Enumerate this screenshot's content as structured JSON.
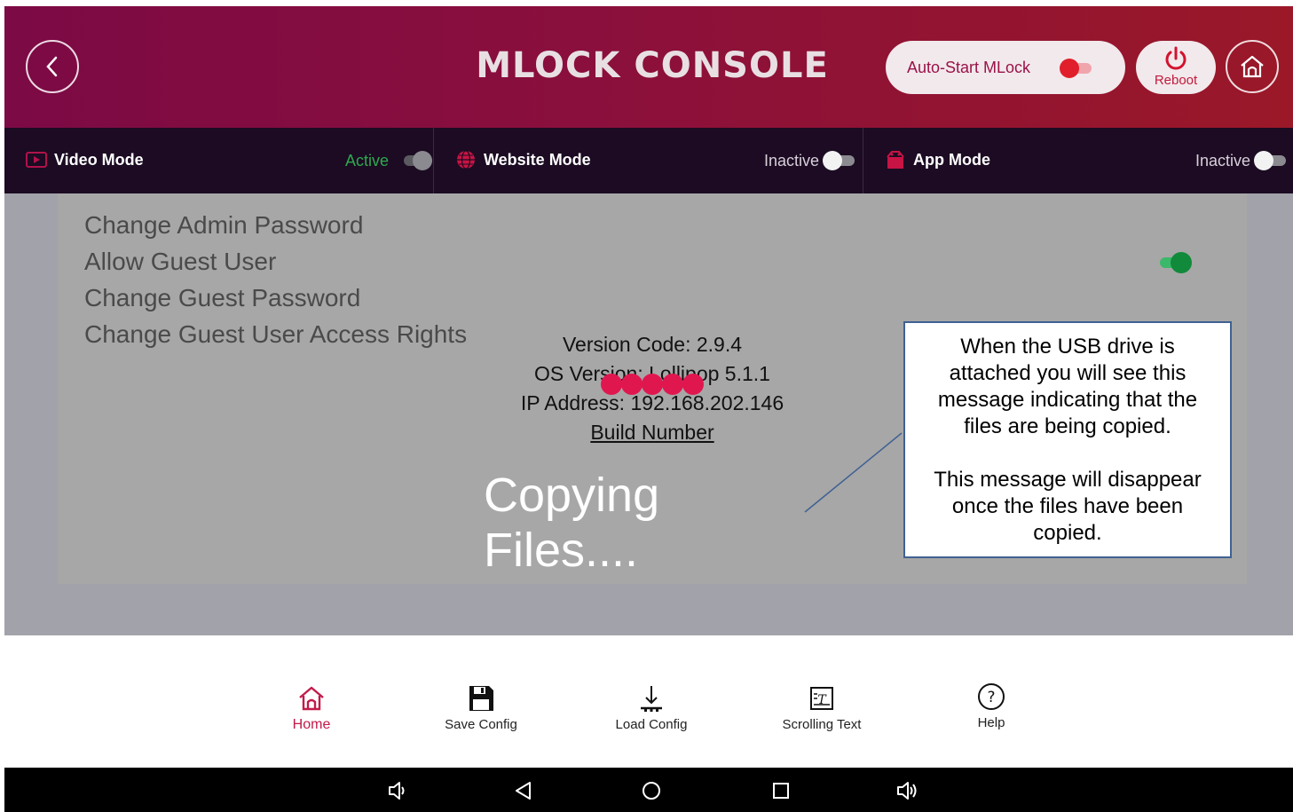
{
  "header": {
    "title": "MLOCK CONSOLE",
    "autostart_label": "Auto-Start MLock",
    "autostart_on": false,
    "reboot_label": "Reboot"
  },
  "modes": [
    {
      "label": "Video Mode",
      "status": "Active",
      "icon": "video-icon"
    },
    {
      "label": "Website Mode",
      "status": "Inactive",
      "icon": "globe-icon"
    },
    {
      "label": "App Mode",
      "status": "Inactive",
      "icon": "app-icon"
    }
  ],
  "settings": {
    "items": [
      "Change Admin Password",
      "Allow Guest User",
      "Change Guest Password",
      "Change Guest User Access Rights"
    ],
    "allow_guest_enabled": true
  },
  "info": {
    "version_code": "Version Code: 2.9.4",
    "os_version": "OS Version: Lollipop 5.1.1",
    "ip_address": "IP Address: 192.168.202.146",
    "build_number": "Build Number"
  },
  "overlay": {
    "copying": "Copying Files....",
    "progress_dots": 5
  },
  "callout": {
    "paragraph1": "When the USB drive is attached you will see this message indicating that the files are being copied.",
    "paragraph2": "This message will disappear once the files have been copied."
  },
  "toolbar": {
    "home": "Home",
    "save": "Save Config",
    "load": "Load Config",
    "scrolling": "Scrolling Text",
    "help": "Help"
  },
  "colors": {
    "accent": "#c21a4a",
    "header_start": "#7c0a45",
    "header_end": "#9a1828",
    "modes_bg": "#1c0b23",
    "active_green": "#2fa84f"
  }
}
